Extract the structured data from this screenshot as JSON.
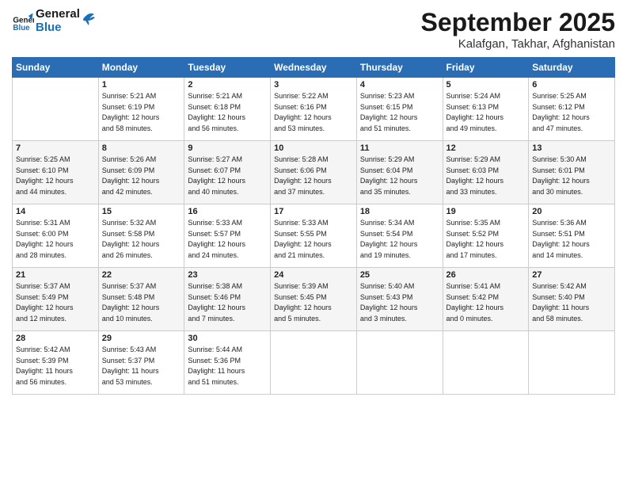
{
  "header": {
    "logo_text_general": "General",
    "logo_text_blue": "Blue",
    "month": "September 2025",
    "location": "Kalafgan, Takhar, Afghanistan"
  },
  "days_header": [
    "Sunday",
    "Monday",
    "Tuesday",
    "Wednesday",
    "Thursday",
    "Friday",
    "Saturday"
  ],
  "weeks": [
    [
      {
        "day": "",
        "info": ""
      },
      {
        "day": "1",
        "info": "Sunrise: 5:21 AM\nSunset: 6:19 PM\nDaylight: 12 hours\nand 58 minutes."
      },
      {
        "day": "2",
        "info": "Sunrise: 5:21 AM\nSunset: 6:18 PM\nDaylight: 12 hours\nand 56 minutes."
      },
      {
        "day": "3",
        "info": "Sunrise: 5:22 AM\nSunset: 6:16 PM\nDaylight: 12 hours\nand 53 minutes."
      },
      {
        "day": "4",
        "info": "Sunrise: 5:23 AM\nSunset: 6:15 PM\nDaylight: 12 hours\nand 51 minutes."
      },
      {
        "day": "5",
        "info": "Sunrise: 5:24 AM\nSunset: 6:13 PM\nDaylight: 12 hours\nand 49 minutes."
      },
      {
        "day": "6",
        "info": "Sunrise: 5:25 AM\nSunset: 6:12 PM\nDaylight: 12 hours\nand 47 minutes."
      }
    ],
    [
      {
        "day": "7",
        "info": "Sunrise: 5:25 AM\nSunset: 6:10 PM\nDaylight: 12 hours\nand 44 minutes."
      },
      {
        "day": "8",
        "info": "Sunrise: 5:26 AM\nSunset: 6:09 PM\nDaylight: 12 hours\nand 42 minutes."
      },
      {
        "day": "9",
        "info": "Sunrise: 5:27 AM\nSunset: 6:07 PM\nDaylight: 12 hours\nand 40 minutes."
      },
      {
        "day": "10",
        "info": "Sunrise: 5:28 AM\nSunset: 6:06 PM\nDaylight: 12 hours\nand 37 minutes."
      },
      {
        "day": "11",
        "info": "Sunrise: 5:29 AM\nSunset: 6:04 PM\nDaylight: 12 hours\nand 35 minutes."
      },
      {
        "day": "12",
        "info": "Sunrise: 5:29 AM\nSunset: 6:03 PM\nDaylight: 12 hours\nand 33 minutes."
      },
      {
        "day": "13",
        "info": "Sunrise: 5:30 AM\nSunset: 6:01 PM\nDaylight: 12 hours\nand 30 minutes."
      }
    ],
    [
      {
        "day": "14",
        "info": "Sunrise: 5:31 AM\nSunset: 6:00 PM\nDaylight: 12 hours\nand 28 minutes."
      },
      {
        "day": "15",
        "info": "Sunrise: 5:32 AM\nSunset: 5:58 PM\nDaylight: 12 hours\nand 26 minutes."
      },
      {
        "day": "16",
        "info": "Sunrise: 5:33 AM\nSunset: 5:57 PM\nDaylight: 12 hours\nand 24 minutes."
      },
      {
        "day": "17",
        "info": "Sunrise: 5:33 AM\nSunset: 5:55 PM\nDaylight: 12 hours\nand 21 minutes."
      },
      {
        "day": "18",
        "info": "Sunrise: 5:34 AM\nSunset: 5:54 PM\nDaylight: 12 hours\nand 19 minutes."
      },
      {
        "day": "19",
        "info": "Sunrise: 5:35 AM\nSunset: 5:52 PM\nDaylight: 12 hours\nand 17 minutes."
      },
      {
        "day": "20",
        "info": "Sunrise: 5:36 AM\nSunset: 5:51 PM\nDaylight: 12 hours\nand 14 minutes."
      }
    ],
    [
      {
        "day": "21",
        "info": "Sunrise: 5:37 AM\nSunset: 5:49 PM\nDaylight: 12 hours\nand 12 minutes."
      },
      {
        "day": "22",
        "info": "Sunrise: 5:37 AM\nSunset: 5:48 PM\nDaylight: 12 hours\nand 10 minutes."
      },
      {
        "day": "23",
        "info": "Sunrise: 5:38 AM\nSunset: 5:46 PM\nDaylight: 12 hours\nand 7 minutes."
      },
      {
        "day": "24",
        "info": "Sunrise: 5:39 AM\nSunset: 5:45 PM\nDaylight: 12 hours\nand 5 minutes."
      },
      {
        "day": "25",
        "info": "Sunrise: 5:40 AM\nSunset: 5:43 PM\nDaylight: 12 hours\nand 3 minutes."
      },
      {
        "day": "26",
        "info": "Sunrise: 5:41 AM\nSunset: 5:42 PM\nDaylight: 12 hours\nand 0 minutes."
      },
      {
        "day": "27",
        "info": "Sunrise: 5:42 AM\nSunset: 5:40 PM\nDaylight: 11 hours\nand 58 minutes."
      }
    ],
    [
      {
        "day": "28",
        "info": "Sunrise: 5:42 AM\nSunset: 5:39 PM\nDaylight: 11 hours\nand 56 minutes."
      },
      {
        "day": "29",
        "info": "Sunrise: 5:43 AM\nSunset: 5:37 PM\nDaylight: 11 hours\nand 53 minutes."
      },
      {
        "day": "30",
        "info": "Sunrise: 5:44 AM\nSunset: 5:36 PM\nDaylight: 11 hours\nand 51 minutes."
      },
      {
        "day": "",
        "info": ""
      },
      {
        "day": "",
        "info": ""
      },
      {
        "day": "",
        "info": ""
      },
      {
        "day": "",
        "info": ""
      }
    ]
  ]
}
